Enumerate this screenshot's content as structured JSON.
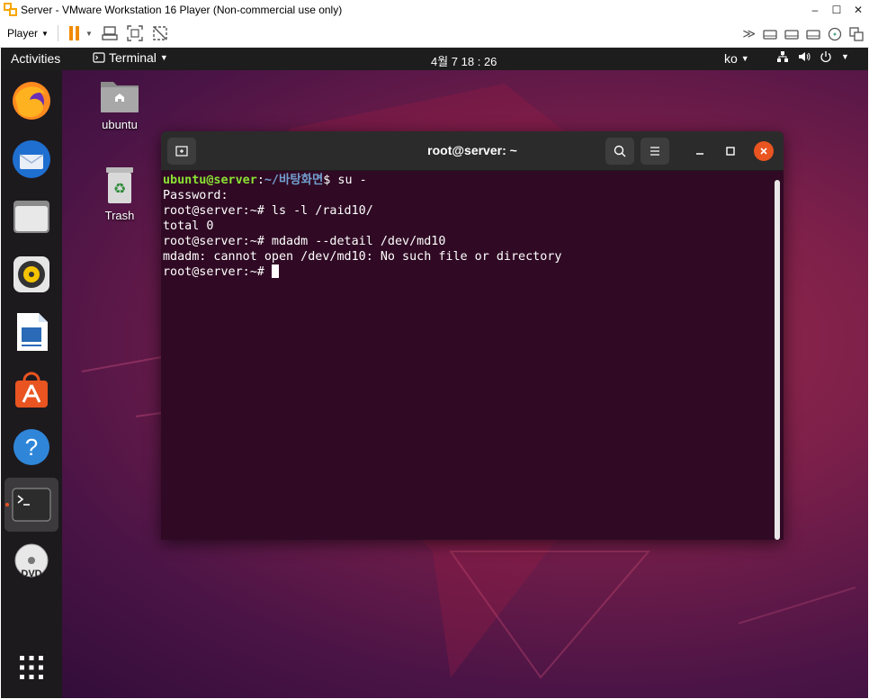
{
  "vmware": {
    "title": "Server - VMware Workstation 16 Player (Non-commercial use only)",
    "window_controls": {
      "minimize": "–",
      "maximize": "☐",
      "close": "✕"
    },
    "toolbar": {
      "player_label": "Player",
      "icons": [
        "pause-icon",
        "send-ctrl-alt-del-icon",
        "fullscreen-icon",
        "unity-icon"
      ],
      "device_icons": [
        "more-devices-icon",
        "hard-disk-icon",
        "hard-disk-2-icon",
        "network-adapter-icon",
        "cd-dvd-icon",
        "display-icon"
      ]
    }
  },
  "ubuntu": {
    "topbar": {
      "activities": "Activities",
      "app_menu": "Terminal",
      "clock": "4월 7  18 : 26",
      "input_method": "ko"
    },
    "dock": [
      {
        "name": "firefox",
        "icon": "firefox-icon"
      },
      {
        "name": "thunderbird",
        "icon": "thunderbird-icon"
      },
      {
        "name": "files",
        "icon": "files-icon"
      },
      {
        "name": "rhythmbox",
        "icon": "rhythmbox-icon"
      },
      {
        "name": "libreoffice-writer",
        "icon": "writer-icon"
      },
      {
        "name": "ubuntu-software",
        "icon": "software-icon"
      },
      {
        "name": "help",
        "icon": "help-icon"
      },
      {
        "name": "terminal",
        "icon": "terminal-icon",
        "running": true
      },
      {
        "name": "dvd",
        "icon": "dvd-icon"
      },
      {
        "name": "show-applications",
        "icon": "app-grid-icon"
      }
    ],
    "desktop_icons": {
      "home_label": "ubuntu",
      "trash_label": "Trash"
    },
    "terminal": {
      "title": "root@server: ~",
      "lines": [
        {
          "user": "ubuntu@server",
          "sep": ":",
          "path": "~/바탕화면",
          "rest": "$ su -"
        },
        {
          "text": "Password:"
        },
        {
          "text": "root@server:~# ls -l /raid10/"
        },
        {
          "text": "total 0"
        },
        {
          "text": "root@server:~# mdadm --detail /dev/md10"
        },
        {
          "text": "mdadm: cannot open /dev/md10: No such file or directory"
        },
        {
          "text": "root@server:~# "
        }
      ]
    },
    "colors": {
      "terminal_bg": "#300a24",
      "prompt_user": "#8ae234",
      "prompt_path": "#729fcf",
      "accent": "#e95420",
      "vmware_accent": "#f08a00"
    }
  }
}
